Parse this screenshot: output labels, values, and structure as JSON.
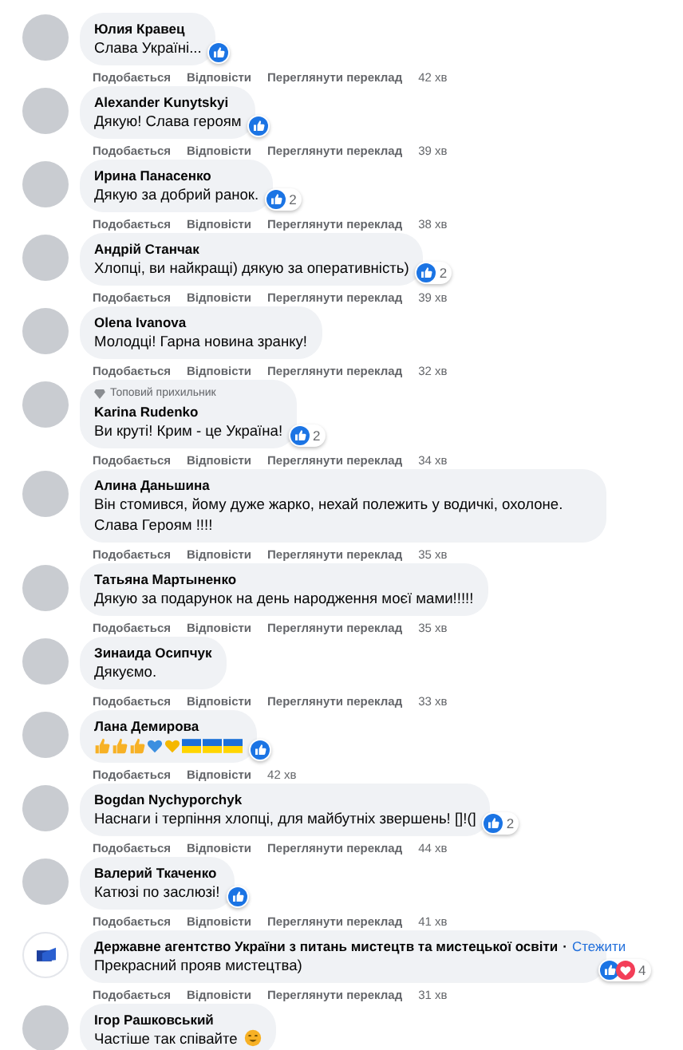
{
  "comments": [
    {
      "kind": "person",
      "author": "Юлия Кравец",
      "text": "Слава Україні...",
      "reactions": [
        {
          "kind": "like"
        }
      ],
      "actions": [
        "Подобається",
        "Відповісти",
        "Переглянути переклад"
      ],
      "time": "42 хв"
    },
    {
      "kind": "person",
      "author": "Alexander Kunytskyi",
      "text": "Дякую! Слава героям",
      "reactions": [
        {
          "kind": "like"
        }
      ],
      "actions": [
        "Подобається",
        "Відповісти",
        "Переглянути переклад"
      ],
      "time": "39 хв"
    },
    {
      "kind": "person",
      "author": "Ирина Панасенко",
      "text": "Дякую за добрий ранок.",
      "reactions": [
        {
          "kind": "like"
        }
      ],
      "reaction_count": "2",
      "actions": [
        "Подобається",
        "Відповісти",
        "Переглянути переклад"
      ],
      "time": "38 хв"
    },
    {
      "kind": "person",
      "author": "Андрій Станчак",
      "text": "Хлопці, ви найкращі) дякую за оперативність)",
      "reactions": [
        {
          "kind": "like"
        }
      ],
      "reaction_count": "2",
      "actions": [
        "Подобається",
        "Відповісти",
        "Переглянути переклад"
      ],
      "time": "39 хв"
    },
    {
      "kind": "person",
      "author": "Olena Ivanova",
      "text": "Молодці! Гарна новина зранку!",
      "actions": [
        "Подобається",
        "Відповісти",
        "Переглянути переклад"
      ],
      "time": "32 хв"
    },
    {
      "kind": "person",
      "badge": "Топовий прихильник",
      "author": "Karina Rudenko",
      "text": "Ви круті! Крим - це Україна!",
      "reactions": [
        {
          "kind": "like"
        }
      ],
      "reaction_count": "2",
      "actions": [
        "Подобається",
        "Відповісти",
        "Переглянути переклад"
      ],
      "time": "34 хв"
    },
    {
      "kind": "person",
      "author": "Алина Даньшина",
      "text": "Він стомився, йому дуже жарко, нехай полежить у водичкі, охолоне. Слава Героям !!!!",
      "actions": [
        "Подобається",
        "Відповісти",
        "Переглянути переклад"
      ],
      "time": "35 хв"
    },
    {
      "kind": "person",
      "author": "Татьяна Мартыненко",
      "text": "Дякую за подарунок на день народження моєї мами!!!!!",
      "actions": [
        "Подобається",
        "Відповісти",
        "Переглянути переклад"
      ],
      "time": "35 хв"
    },
    {
      "kind": "person",
      "author": "Зинаида Осипчук",
      "text": "Дякуємо.",
      "actions": [
        "Подобається",
        "Відповісти",
        "Переглянути переклад"
      ],
      "time": "33 хв"
    },
    {
      "kind": "person",
      "author": "Лана Демирова",
      "emoji": [
        {
          "kind": "thumb"
        },
        {
          "kind": "thumb"
        },
        {
          "kind": "thumb"
        },
        {
          "kind": "blue-heart"
        },
        {
          "kind": "yellow-heart"
        },
        {
          "kind": "flag"
        },
        {
          "kind": "flag"
        },
        {
          "kind": "flag"
        }
      ],
      "reactions": [
        {
          "kind": "like"
        }
      ],
      "actions": [
        "Подобається",
        "Відповісти"
      ],
      "time": "42 хв"
    },
    {
      "kind": "person",
      "author": "Bogdan Nychyporchyk",
      "text": "Наснаги і терпіння хлопці, для майбутніх звершень! []!(]",
      "reactions": [
        {
          "kind": "like"
        }
      ],
      "reaction_count": "2",
      "actions": [
        "Подобається",
        "Відповісти",
        "Переглянути переклад"
      ],
      "time": "44 хв"
    },
    {
      "kind": "person",
      "author": "Валерий Ткаченко",
      "text": "Катюзі по заслюзі!",
      "reactions": [
        {
          "kind": "like"
        }
      ],
      "actions": [
        "Подобається",
        "Відповісти",
        "Переглянути переклад"
      ],
      "time": "41 хв"
    },
    {
      "kind": "page",
      "author": "Державне агентство України з питань мистецтв та мистецької освіти",
      "separator": "·",
      "follow": "Стежити",
      "text": "Прекрасний прояв мистецтва)",
      "reactions": [
        {
          "kind": "like"
        },
        {
          "kind": "love"
        }
      ],
      "reaction_count": "4",
      "actions": [
        "Подобається",
        "Відповісти",
        "Переглянути переклад"
      ],
      "time": "31 хв"
    },
    {
      "kind": "person",
      "author": "Ігор Рашковський",
      "text": "Частіше так співайте",
      "emoji": [
        {
          "kind": "face"
        }
      ]
    }
  ]
}
